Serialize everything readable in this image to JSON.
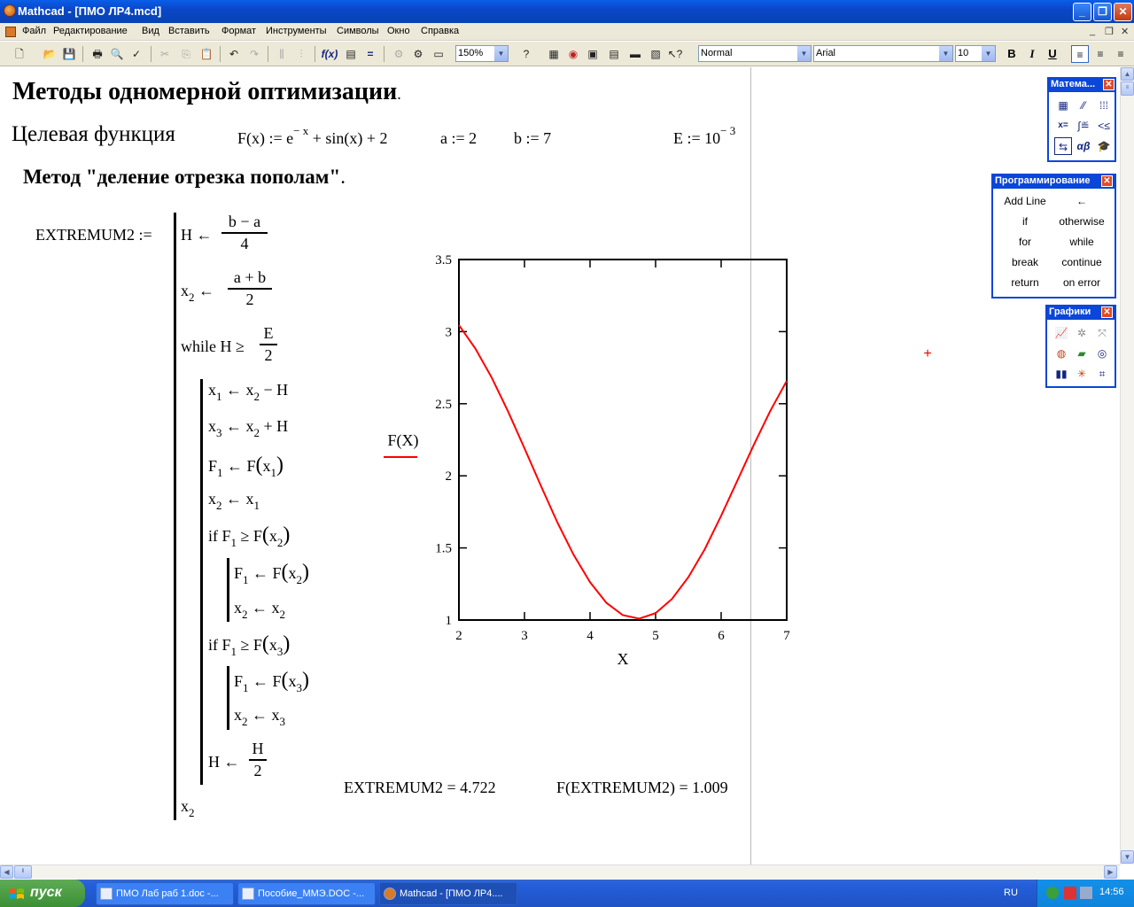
{
  "window": {
    "title": "Mathcad - [ПМО ЛР4.mcd]",
    "btn_min": "_",
    "btn_max": "❐",
    "btn_close": "✕"
  },
  "menu": [
    "Файл",
    "Редактирование",
    "Вид",
    "Вставить",
    "Формат",
    "Инструменты",
    "Символы",
    "Окно",
    "Справка"
  ],
  "mdi_buttons": [
    "_",
    "❐",
    "✕"
  ],
  "toolbar": {
    "zoom": "150%",
    "style": "Normal",
    "font": "Arial",
    "size": "10",
    "bold": "B",
    "italic": "I",
    "underline": "U"
  },
  "doc": {
    "heading": "Методы одномерной оптимизации",
    "heading_dot": ".",
    "target_label": "Целевая функция",
    "func_def": "F(x) := e",
    "func_exp": "− x",
    "func_rest": "+ sin(x) + 2",
    "a_def": "a := 2",
    "b_def": "b := 7",
    "e_def": "E := 10",
    "e_exp": "− 3",
    "method_title": "Метод  \"деление отрезка пополам\"",
    "method_dot": ".",
    "extremum_label": "EXTREMUM2 :=",
    "prog": {
      "H_assign": "H ←",
      "H_num": "b − a",
      "H_den": "4",
      "x2_assign": "← ",
      "x2_num": "a + b",
      "x2_den": "2",
      "while_text": "while H ≥",
      "while_num": "E",
      "while_den": "2",
      "H_update": "H ←",
      "H_update_num": "H",
      "H_update_den": "2",
      "ret": "x"
    },
    "result_ext": "EXTREMUM2 = 4.722",
    "result_f": "F(EXTREMUM2) = 1.009"
  },
  "chart_data": {
    "type": "line",
    "xlabel": "X",
    "ylabel": "",
    "legend": "F(X)",
    "xlim": [
      2,
      7
    ],
    "ylim": [
      1,
      3.5
    ],
    "xticks": [
      "2",
      "3",
      "4",
      "5",
      "6",
      "7"
    ],
    "yticks": [
      "1",
      "1.5",
      "2",
      "2.5",
      "3",
      "3.5"
    ],
    "color": "#ff0000",
    "series": [
      {
        "name": "F(X)",
        "x": [
          2,
          2.25,
          2.5,
          2.75,
          3,
          3.25,
          3.5,
          3.75,
          4,
          4.25,
          4.5,
          4.75,
          5,
          5.25,
          5.5,
          5.75,
          6,
          6.25,
          6.5,
          6.75,
          7
        ],
        "y": [
          3.045,
          2.883,
          2.681,
          2.446,
          2.191,
          1.931,
          1.679,
          1.452,
          1.262,
          1.119,
          1.034,
          1.009,
          1.048,
          1.146,
          1.297,
          1.491,
          1.723,
          1.969,
          2.217,
          2.451,
          2.658
        ]
      }
    ]
  },
  "panels": {
    "math": {
      "title": "Матема..."
    },
    "prog": {
      "title": "Программирование",
      "buttons": [
        "Add Line",
        "←",
        "if",
        "otherwise",
        "for",
        "while",
        "break",
        "continue",
        "return",
        "on error"
      ]
    },
    "graphs": {
      "title": "Графики"
    }
  },
  "taskbar": {
    "start": "пуск",
    "tasks": [
      "ПМО Лаб раб 1.doc -...",
      "Пособие_ММЭ.DOC -...",
      "Mathcad - [ПМО ЛР4...."
    ],
    "lang": "RU",
    "time": "14:56"
  }
}
